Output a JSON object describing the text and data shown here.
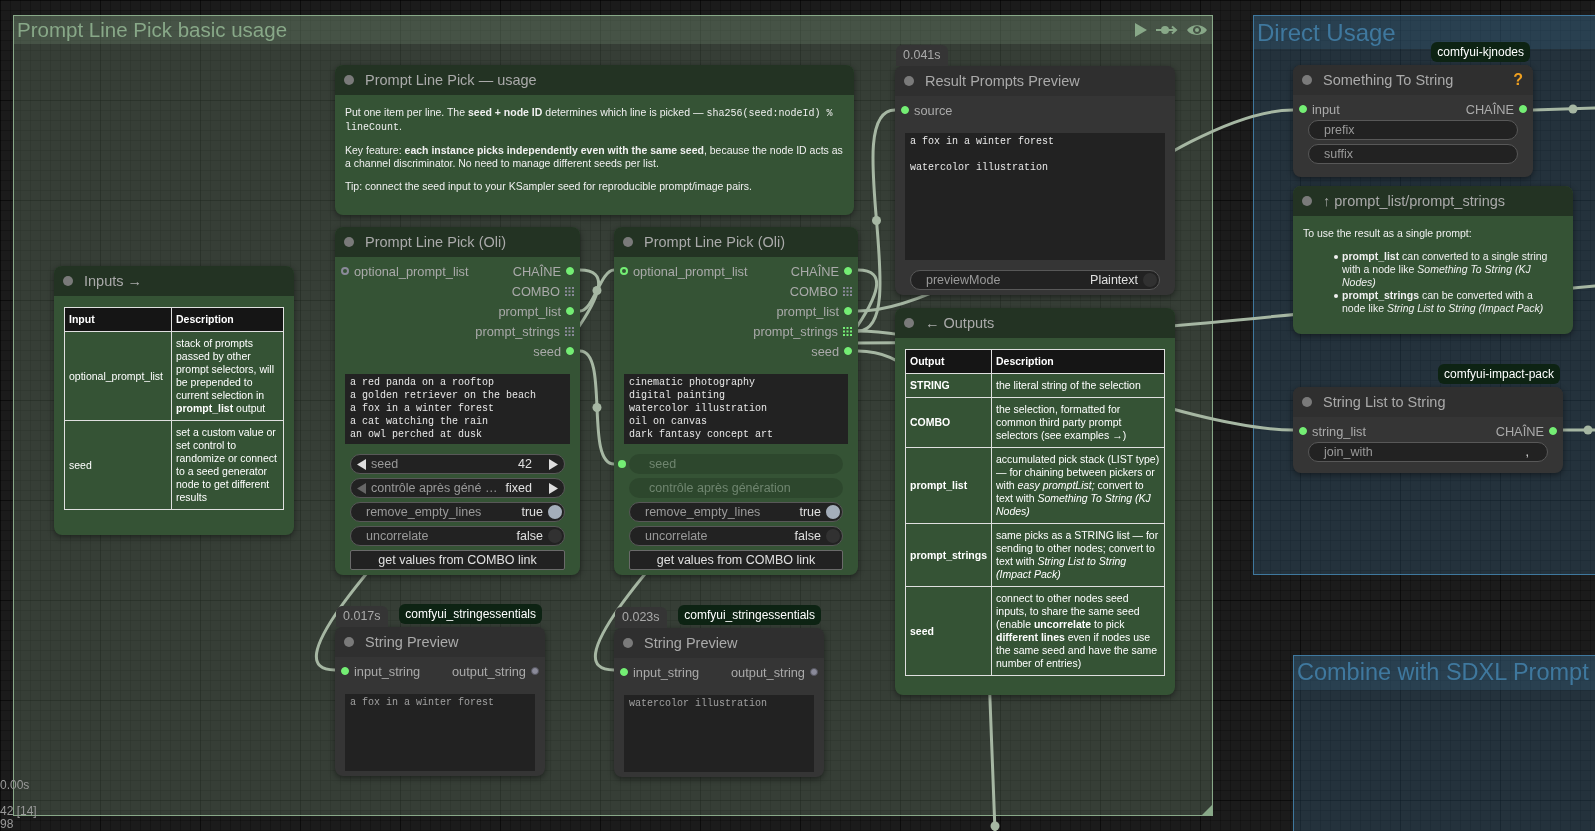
{
  "groups": [
    {
      "title": "Prompt Line Pick basic usage",
      "color": "#88a888",
      "selected": true
    },
    {
      "title": "Direct Usage",
      "color": "#3f789e",
      "selected": false
    },
    {
      "title": "Combine with SDXL Prompt",
      "color": "#3f789e",
      "selected": false
    }
  ],
  "nodes": [
    {
      "kind": "note",
      "header": {
        "title": "Prompt Line Pick — usage",
        "color": "#233323"
      },
      "color": "#355335",
      "paragraphs": [
        [
          {
            "kind": "text",
            "text": "Put one item per line. The **seed + node ID** determines which line is picked — "
          },
          {
            "kind": "code",
            "text": "sha256(seed:nodeId) % lineCount"
          },
          {
            "kind": "text",
            "text": "."
          }
        ],
        [
          {
            "kind": "text",
            "text": "Key feature: **each instance picks independently even with the same seed**, because the node ID acts as a channel discriminator. No need to manage different seeds per list."
          }
        ],
        [
          {
            "kind": "text",
            "text": "Tip: connect the seed input to your KSampler seed for reproducible prompt/image pairs."
          }
        ]
      ]
    },
    {
      "kind": "node",
      "header": {
        "title": "Result Prompts Preview",
        "color": "#2f2f2f"
      },
      "color": "#353535",
      "timing": "0.041s",
      "slots": [
        {
          "input": {
            "label": "source",
            "connected": true,
            "optional": false
          }
        }
      ],
      "textarea": {
        "text": "a fox in a winter forest\n\nwatercolor illustration",
        "readonly": false
      },
      "widgets": [
        {
          "kind": "toggle",
          "label": "previewMode",
          "value": "Plaintext",
          "on": false
        }
      ]
    },
    {
      "kind": "node",
      "header": {
        "title": "Something To String",
        "color": "#2f2f2f",
        "help": "?"
      },
      "color": "#353535",
      "badge": "comfyui-kjnodes",
      "slots": [
        {
          "input": {
            "label": "input",
            "connected": true,
            "optional": false
          },
          "output": {
            "label": "CHAÎNE",
            "connected": true,
            "kind": "dot"
          }
        }
      ],
      "widgets": [
        {
          "kind": "text",
          "label": "prefix"
        },
        {
          "kind": "text",
          "label": "suffix"
        }
      ]
    },
    {
      "kind": "note",
      "header": {
        "title": "↑ prompt_list/prompt_strings",
        "color": "#233323"
      },
      "color": "#355335",
      "paragraphs": [
        [
          {
            "kind": "text",
            "text": "To use the result as a single prompt:"
          }
        ]
      ],
      "bullets": [
        "**prompt_list** can converted to a single string with a node like *Something To String (KJ Nodes)*",
        "**prompt_strings** can be converted with a node like *String List to String (Impact Pack)*"
      ]
    },
    {
      "kind": "node",
      "header": {
        "title": "Prompt Line Pick (Oli)",
        "color": "#233323"
      },
      "color": "#355335",
      "slots": [
        {
          "input": {
            "label": "optional_prompt_list",
            "connected": false,
            "optional": true
          },
          "output": {
            "label": "CHAÎNE",
            "connected": true,
            "kind": "dot"
          }
        },
        {
          "output": {
            "label": "COMBO",
            "connected": false,
            "kind": "grid"
          }
        },
        {
          "output": {
            "label": "prompt_list",
            "connected": true,
            "kind": "dot"
          }
        },
        {
          "output": {
            "label": "prompt_strings",
            "connected": false,
            "kind": "grid"
          }
        },
        {
          "output": {
            "label": "seed",
            "connected": true,
            "kind": "dot"
          }
        }
      ],
      "textarea": {
        "text": "a red panda on a rooftop\na golden retriever on the beach\na fox in a winter forest\na cat watching the rain\nan owl perched at dusk",
        "readonly": false
      },
      "widgets": [
        {
          "kind": "number",
          "label": "seed",
          "value": "42",
          "disabled": false,
          "linked": false
        },
        {
          "kind": "combo",
          "label": "contrôle après géné …",
          "value": "fixed",
          "disabled": false
        },
        {
          "kind": "toggle",
          "label": "remove_empty_lines",
          "value": "true",
          "on": true
        },
        {
          "kind": "toggle",
          "label": "uncorrelate",
          "value": "false",
          "on": false
        },
        {
          "kind": "button",
          "label": "get values from COMBO link"
        }
      ]
    },
    {
      "kind": "node",
      "header": {
        "title": "Prompt Line Pick (Oli)",
        "color": "#233323"
      },
      "color": "#355335",
      "slots": [
        {
          "input": {
            "label": "optional_prompt_list",
            "connected": true,
            "optional": true
          },
          "output": {
            "label": "CHAÎNE",
            "connected": true,
            "kind": "dot"
          }
        },
        {
          "output": {
            "label": "COMBO",
            "connected": false,
            "kind": "grid"
          }
        },
        {
          "output": {
            "label": "prompt_list",
            "connected": true,
            "kind": "dot"
          }
        },
        {
          "output": {
            "label": "prompt_strings",
            "connected": true,
            "kind": "grid"
          }
        },
        {
          "output": {
            "label": "seed",
            "connected": true,
            "kind": "dot"
          }
        }
      ],
      "textarea": {
        "text": "cinematic photography\ndigital painting\nwatercolor illustration\noil on canvas\ndark fantasy concept art",
        "readonly": false
      },
      "widgets": [
        {
          "kind": "number",
          "label": "seed",
          "disabled": true,
          "linked": true
        },
        {
          "kind": "combo",
          "label": "contrôle après génération",
          "disabled": true
        },
        {
          "kind": "toggle",
          "label": "remove_empty_lines",
          "value": "true",
          "on": true
        },
        {
          "kind": "toggle",
          "label": "uncorrelate",
          "value": "false",
          "on": false
        },
        {
          "kind": "button",
          "label": "get values from COMBO link"
        }
      ]
    },
    {
      "kind": "note",
      "header": {
        "title": "Inputs →",
        "color": "#233323"
      },
      "color": "#355335",
      "table": {
        "columns": [
          "Input",
          "Description"
        ],
        "bold_first_column": false,
        "rows": [
          [
            "optional_prompt_list",
            "stack of prompts passed by other prompt selectors, will be prepended to current selection in **prompt_list** output"
          ],
          [
            "seed",
            "set a custom value or set control to randomize or connect to a seed generator node to get different results"
          ]
        ]
      }
    },
    {
      "kind": "note",
      "header": {
        "title": "← Outputs",
        "color": "#233323"
      },
      "color": "#355335",
      "table": {
        "columns": [
          "Output",
          "Description"
        ],
        "bold_first_column": true,
        "rows": [
          [
            "STRING",
            "the literal string of the selection"
          ],
          [
            "COMBO",
            "the selection, formatted for common third party prompt selectors (see examples →)"
          ],
          [
            "prompt_list",
            "accumulated pick stack (LIST type) — for chaining between pickers or with *easy promptList;* convert to text with *Something To String (KJ Nodes)*"
          ],
          [
            "prompt_strings",
            "same picks as a STRING list — for sending to other nodes; convert to text with *String List to String (Impact Pack)*"
          ],
          [
            "seed",
            "connect to other nodes seed inputs, to share the same seed (enable **uncorrelate** to pick **different lines** even if nodes use the same seed and have the same number of entries)"
          ]
        ]
      }
    },
    {
      "kind": "node",
      "header": {
        "title": "String List to String",
        "color": "#2f2f2f"
      },
      "color": "#353535",
      "badge": "comfyui-impact-pack",
      "slots": [
        {
          "input": {
            "label": "string_list",
            "connected": true,
            "optional": false
          },
          "output": {
            "label": "CHAÎNE",
            "connected": true,
            "kind": "dot"
          }
        }
      ],
      "widgets": [
        {
          "kind": "text",
          "label": "join_with",
          "value": ","
        }
      ]
    },
    {
      "kind": "node",
      "header": {
        "title": "String Preview",
        "color": "#2f2f2f"
      },
      "color": "#353535",
      "timing": "0.017s",
      "badge": "comfyui_stringessentials",
      "slots": [
        {
          "input": {
            "label": "input_string",
            "connected": true,
            "optional": false
          },
          "output": {
            "label": "output_string",
            "connected": false,
            "kind": "dot"
          }
        }
      ],
      "textarea": {
        "text": "a fox in a winter forest",
        "readonly": true
      }
    },
    {
      "kind": "node",
      "header": {
        "title": "String Preview",
        "color": "#2f2f2f"
      },
      "color": "#353535",
      "timing": "0.023s",
      "badge": "comfyui_stringessentials",
      "slots": [
        {
          "input": {
            "label": "input_string",
            "connected": true,
            "optional": false
          },
          "output": {
            "label": "output_string",
            "connected": false,
            "kind": "dot"
          }
        }
      ],
      "textarea": {
        "text": "watercolor illustration",
        "readonly": true
      }
    }
  ],
  "canvas_info": [
    "0.00s",
    "42 [14]",
    "98"
  ]
}
